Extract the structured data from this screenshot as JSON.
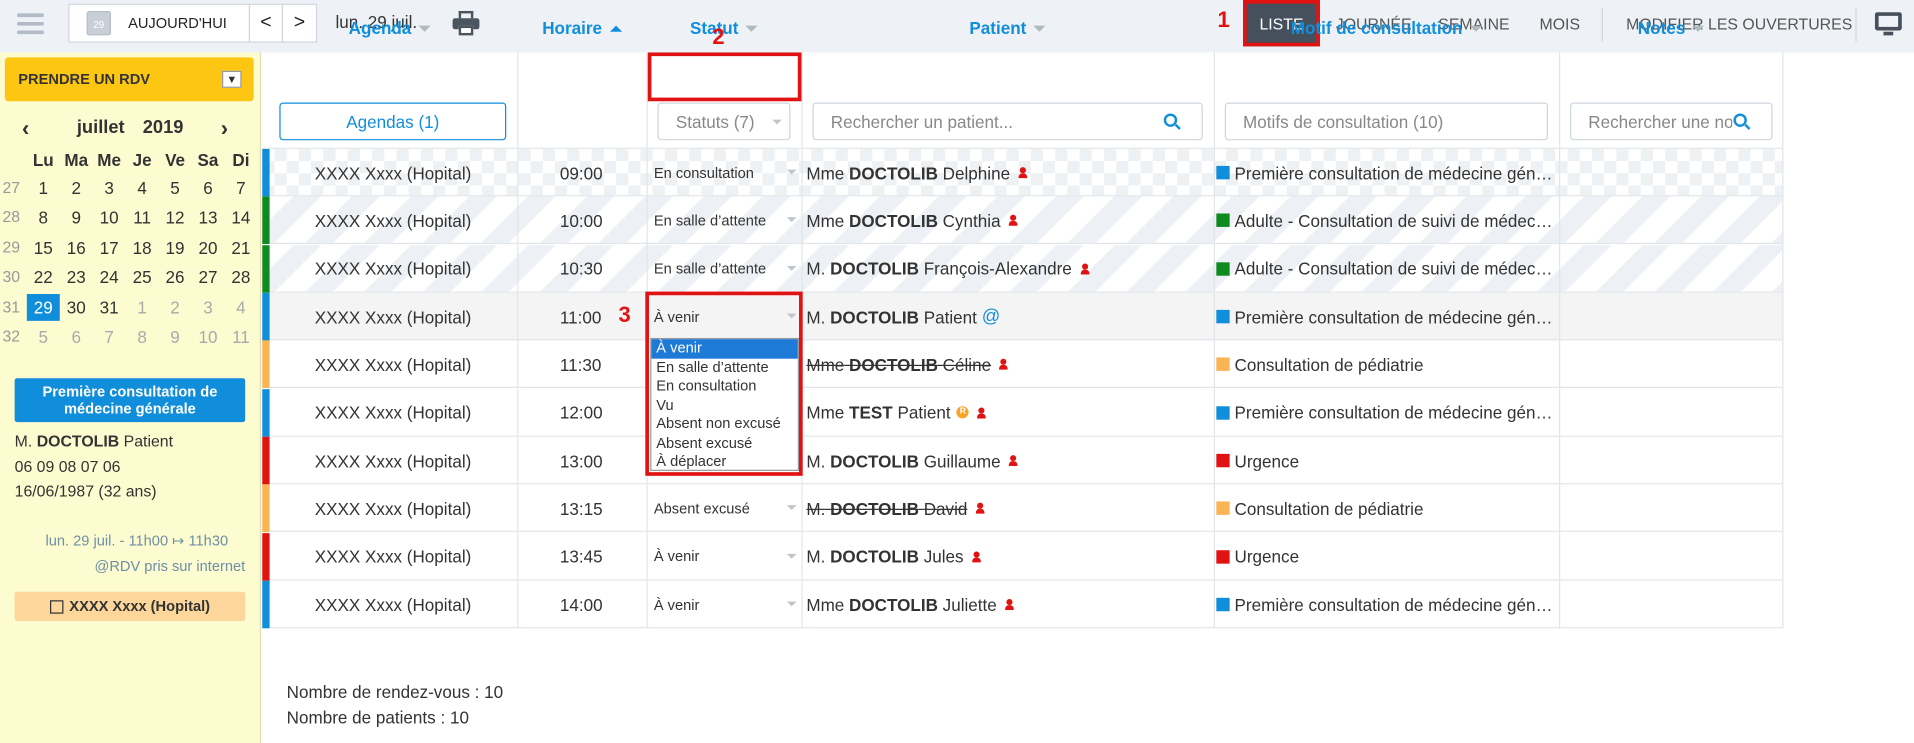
{
  "topbar": {
    "today_label": "AUJOURD'HUI",
    "cal_icon_day": "29",
    "prev": "<",
    "next": ">",
    "current_date": "lun. 29 juil.",
    "views": [
      "LISTE",
      "JOURNÉE",
      "SEMAINE",
      "MOIS"
    ],
    "modify_label": "MODIFIER LES OUVERTURES"
  },
  "left": {
    "rdv_button": "PRENDRE UN RDV",
    "calendar": {
      "month": "juillet",
      "year": "2019",
      "day_headers": [
        "Lu",
        "Ma",
        "Me",
        "Je",
        "Ve",
        "Sa",
        "Di"
      ],
      "weeks": [
        {
          "num": "27",
          "days": [
            "1",
            "2",
            "3",
            "4",
            "5",
            "6",
            "7"
          ]
        },
        {
          "num": "28",
          "days": [
            "8",
            "9",
            "10",
            "11",
            "12",
            "13",
            "14"
          ]
        },
        {
          "num": "29",
          "days": [
            "15",
            "16",
            "17",
            "18",
            "19",
            "20",
            "21"
          ]
        },
        {
          "num": "30",
          "days": [
            "22",
            "23",
            "24",
            "25",
            "26",
            "27",
            "28"
          ]
        },
        {
          "num": "31",
          "days": [
            "29",
            "30",
            "31",
            "1",
            "2",
            "3",
            "4"
          ]
        },
        {
          "num": "32",
          "days": [
            "5",
            "6",
            "7",
            "8",
            "9",
            "10",
            "11"
          ]
        }
      ]
    },
    "appointment_card": {
      "title": "Première consultation de médecine générale",
      "patient_prefix": "M.",
      "patient_last": "DOCTOLIB",
      "patient_first": "Patient",
      "phone": "06 09 08 07 06",
      "birth": "16/06/1987 (32 ans)",
      "time": "lun. 29 juil. - 11h00 ↦ 11h30",
      "booked": "@RDV pris sur internet",
      "agenda": "XXXX Xxxx (Hopital)"
    }
  },
  "table": {
    "headers": {
      "agenda": "Agenda",
      "horaire": "Horaire",
      "statut": "Statut",
      "patient": "Patient",
      "motif": "Motif de consultation",
      "notes": "Notes"
    },
    "filters": {
      "agenda": "Agendas (1)",
      "statut": "Statuts (7)",
      "patient_placeholder": "Rechercher un patient...",
      "motif": "Motifs de consultation (10)",
      "notes_placeholder": "Rechercher une note"
    },
    "rows": [
      {
        "agenda": "XXXX Xxxx (Hopital)",
        "time": "09:00",
        "status": "En consultation",
        "prefix": "Mme",
        "last": "DOCTOLIB",
        "first": "Delphine",
        "motif": "Première consultation de médecine gén…",
        "bar": "#118edb",
        "motif_color": "#118edb"
      },
      {
        "agenda": "XXXX Xxxx (Hopital)",
        "time": "10:00",
        "status": "En salle d’attente",
        "prefix": "Mme",
        "last": "DOCTOLIB",
        "first": "Cynthia",
        "motif": "Adulte - Consultation de suivi de médec…",
        "bar": "#0f8a1f",
        "motif_color": "#0f8a1f"
      },
      {
        "agenda": "XXXX Xxxx (Hopital)",
        "time": "10:30",
        "status": "En salle d’attente",
        "prefix": "M.",
        "last": "DOCTOLIB",
        "first": "François-Alexandre",
        "motif": "Adulte - Consultation de suivi de médec…",
        "bar": "#0f8a1f",
        "motif_color": "#0f8a1f"
      },
      {
        "agenda": "XXXX Xxxx (Hopital)",
        "time": "11:00",
        "status": "À venir",
        "prefix": "M.",
        "last": "DOCTOLIB",
        "first": "Patient",
        "motif": "Première consultation de médecine gén…",
        "bar": "#118edb",
        "motif_color": "#118edb"
      },
      {
        "agenda": "XXXX Xxxx (Hopital)",
        "time": "11:30",
        "status": "",
        "prefix": "Mme",
        "last": "DOCTOLIB",
        "first": "Céline",
        "motif": "Consultation de pédiatrie",
        "bar": "#f9b454",
        "motif_color": "#f9b454"
      },
      {
        "agenda": "XXXX Xxxx (Hopital)",
        "time": "12:00",
        "status": "",
        "prefix": "Mme",
        "last": "TEST",
        "first": "Patient",
        "motif": "Première consultation de médecine gén…",
        "bar": "#118edb",
        "motif_color": "#118edb"
      },
      {
        "agenda": "XXXX Xxxx (Hopital)",
        "time": "13:00",
        "status": "",
        "prefix": "M.",
        "last": "DOCTOLIB",
        "first": "Guillaume",
        "motif": "Urgence",
        "bar": "#e11212",
        "motif_color": "#e11212"
      },
      {
        "agenda": "XXXX Xxxx (Hopital)",
        "time": "13:15",
        "status": "Absent excusé",
        "prefix": "M.",
        "last": "DOCTOLIB",
        "first": "David",
        "motif": "Consultation de pédiatrie",
        "bar": "#f9b454",
        "motif_color": "#f9b454"
      },
      {
        "agenda": "XXXX Xxxx (Hopital)",
        "time": "13:45",
        "status": "À venir",
        "prefix": "M.",
        "last": "DOCTOLIB",
        "first": "Jules",
        "motif": "Urgence",
        "bar": "#e11212",
        "motif_color": "#e11212"
      },
      {
        "agenda": "XXXX Xxxx (Hopital)",
        "time": "14:00",
        "status": "À venir",
        "prefix": "Mme",
        "last": "DOCTOLIB",
        "first": "Juliette",
        "motif": "Première consultation de médecine gén…",
        "bar": "#118edb",
        "motif_color": "#118edb"
      }
    ],
    "status_options": [
      "À venir",
      "En salle d’attente",
      "En consultation",
      "Vu",
      "Absent non excusé",
      "Absent excusé",
      "À déplacer"
    ],
    "summary": {
      "rdv": "Nombre de rendez-vous : 10",
      "patients": "Nombre de patients : 10"
    }
  },
  "annotations": {
    "one": "1",
    "two": "2",
    "three": "3"
  },
  "misc": {
    "at_sign": "@",
    "r_badge": "R"
  }
}
